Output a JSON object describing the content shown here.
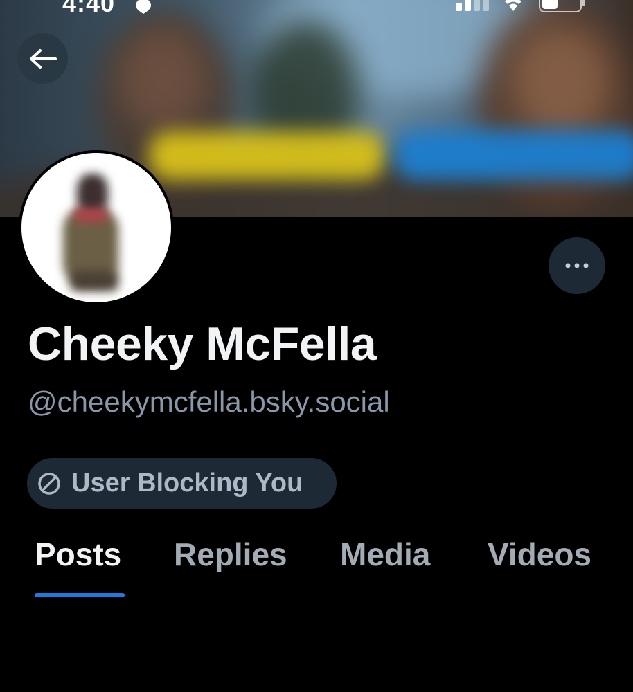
{
  "status_bar": {
    "time": "4:40"
  },
  "profile": {
    "display_name": "Cheeky McFella",
    "handle": "@cheekymcfella.bsky.social",
    "block_badge_label": "User Blocking You"
  },
  "tabs": [
    {
      "label": "Posts",
      "active": true
    },
    {
      "label": "Replies",
      "active": false
    },
    {
      "label": "Media",
      "active": false
    },
    {
      "label": "Videos",
      "active": false
    }
  ],
  "colors": {
    "background": "#000000",
    "accent": "#1f7ae0",
    "badge_bg": "#1e2936",
    "muted_text": "#8a97a8"
  },
  "icons": {
    "back": "arrow-left-icon",
    "more": "ellipsis-icon",
    "blocked": "no-entry-icon",
    "location": "location-arrow-icon",
    "signal": "cell-signal-icon",
    "wifi": "wifi-icon",
    "battery": "battery-icon"
  }
}
